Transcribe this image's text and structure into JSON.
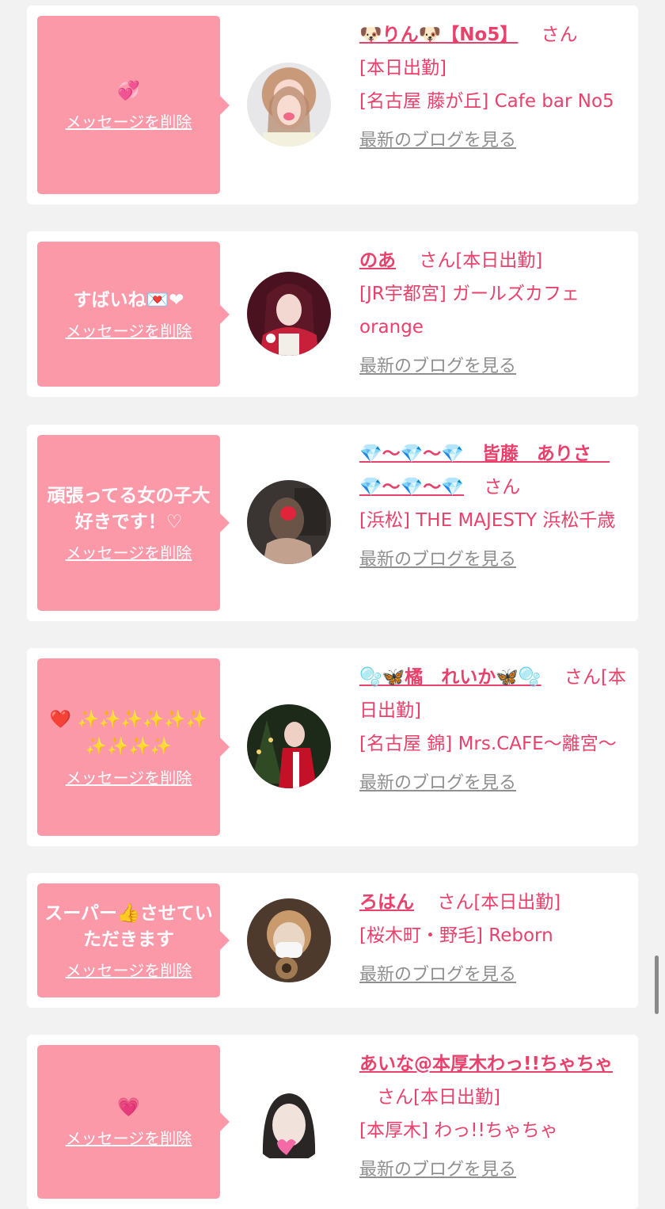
{
  "cards": [
    {
      "message": "💞",
      "delete_label": "メッセージを削除",
      "name": "🐶りん🐶【No5】",
      "honorific": "さん",
      "status": "[本日出勤]",
      "store": "[名古屋 藤が丘] Cafe bar No5",
      "blog_label": "最新のブログを見る",
      "avatar": "girl with dog filter",
      "avatar_colors": [
        "#f0c3c9",
        "#d9c9b6"
      ]
    },
    {
      "message": "すばいね💌❤",
      "delete_label": "メッセージを削除",
      "name": "のあ",
      "honorific": "さん",
      "status": "[本日出勤]",
      "store": "[JR宇都宮] ガールズカフェorange",
      "blog_label": "最新のブログを見る",
      "avatar": "girl in santa outfit",
      "avatar_colors": [
        "#6b1a2a",
        "#e2b7b8"
      ]
    },
    {
      "message": "頑張ってる女の子大好きです！♡",
      "delete_label": "メッセージを削除",
      "name": "💎〜💎〜💎　皆藤　ありさ　💎〜💎〜💎",
      "honorific": "さん",
      "status": "",
      "store": "[浜松] THE MAJESTY 浜松千歳",
      "blog_label": "最新のブログを見る",
      "avatar": "girl with heart sticker",
      "avatar_colors": [
        "#3b3533",
        "#b39384"
      ]
    },
    {
      "message": "❤️ ✨✨✨✨✨✨ ✨✨✨✨",
      "delete_label": "メッセージを削除",
      "name": "🫧🦋橘　れいか🦋🫧",
      "honorific": "さん",
      "status": "[本日出勤]",
      "store": "[名古屋 錦] Mrs.CAFE〜離宮〜",
      "blog_label": "最新のブログを見る",
      "avatar": "girl in red santa dress",
      "avatar_colors": [
        "#1f2e1c",
        "#c1122a"
      ]
    },
    {
      "message": "スーパー👍させていただきます",
      "delete_label": "メッセージを削除",
      "name": "ろはん",
      "honorific": "さん",
      "status": "[本日出勤]",
      "store": "[桜木町・野毛] Reborn",
      "blog_label": "最新のブログを見る",
      "avatar": "girl with mask and dog",
      "avatar_colors": [
        "#5a4130",
        "#d6c0ac"
      ]
    },
    {
      "message": "💗",
      "delete_label": "メッセージを削除",
      "name": "あいな@本厚木わっ!!ちゃちゃ",
      "honorific": "さん",
      "status": "[本日出勤]",
      "store": "[本厚木] わっ!!ちゃちゃ",
      "blog_label": "最新のブログを見る",
      "avatar": "girl with pink heart sticker",
      "avatar_colors": [
        "#ffffff",
        "#2e2a2a"
      ]
    }
  ]
}
